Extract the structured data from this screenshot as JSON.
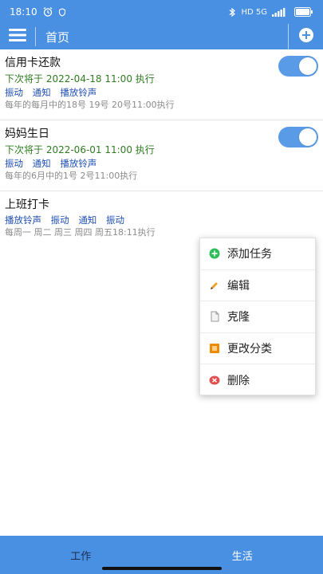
{
  "status": {
    "time": "18:10",
    "right_text": "HD 5G"
  },
  "appbar": {
    "title": "首页"
  },
  "items": [
    {
      "title": "信用卡还款",
      "next_run": "下次将于 2022-04-18 11:00 执行",
      "actions": [
        "振动",
        "通知",
        "播放铃声"
      ],
      "schedule": "每年的每月中的18号 19号 20号11:00执行",
      "enabled": true
    },
    {
      "title": "妈妈生日",
      "next_run": "下次将于 2022-06-01 11:00 执行",
      "actions": [
        "振动",
        "通知",
        "播放铃声"
      ],
      "schedule": "每年的6月中的1号 2号11:00执行",
      "enabled": true
    },
    {
      "title": "上班打卡",
      "actions": [
        "播放铃声",
        "振动",
        "通知",
        "振动"
      ],
      "schedule": "每周一 周二 周三 周四 周五18:11执行"
    }
  ],
  "popup": {
    "items": [
      {
        "label": "添加任务",
        "icon": "plus-circle-icon",
        "color": "#2ebd59"
      },
      {
        "label": "编辑",
        "icon": "pencil-icon",
        "color": "#f0a020"
      },
      {
        "label": "克隆",
        "icon": "document-icon",
        "color": "#9a9a9a"
      },
      {
        "label": "更改分类",
        "icon": "category-icon",
        "color": "#f08a00"
      },
      {
        "label": "删除",
        "icon": "delete-icon",
        "color": "#e05050"
      }
    ]
  },
  "bottom_nav": {
    "tabs": [
      "工作",
      "生活"
    ]
  },
  "colors": {
    "primary": "#4a90e2",
    "next_run": "#2f7d20",
    "action": "#1f4fb5",
    "schedule": "#8b8b8b"
  }
}
